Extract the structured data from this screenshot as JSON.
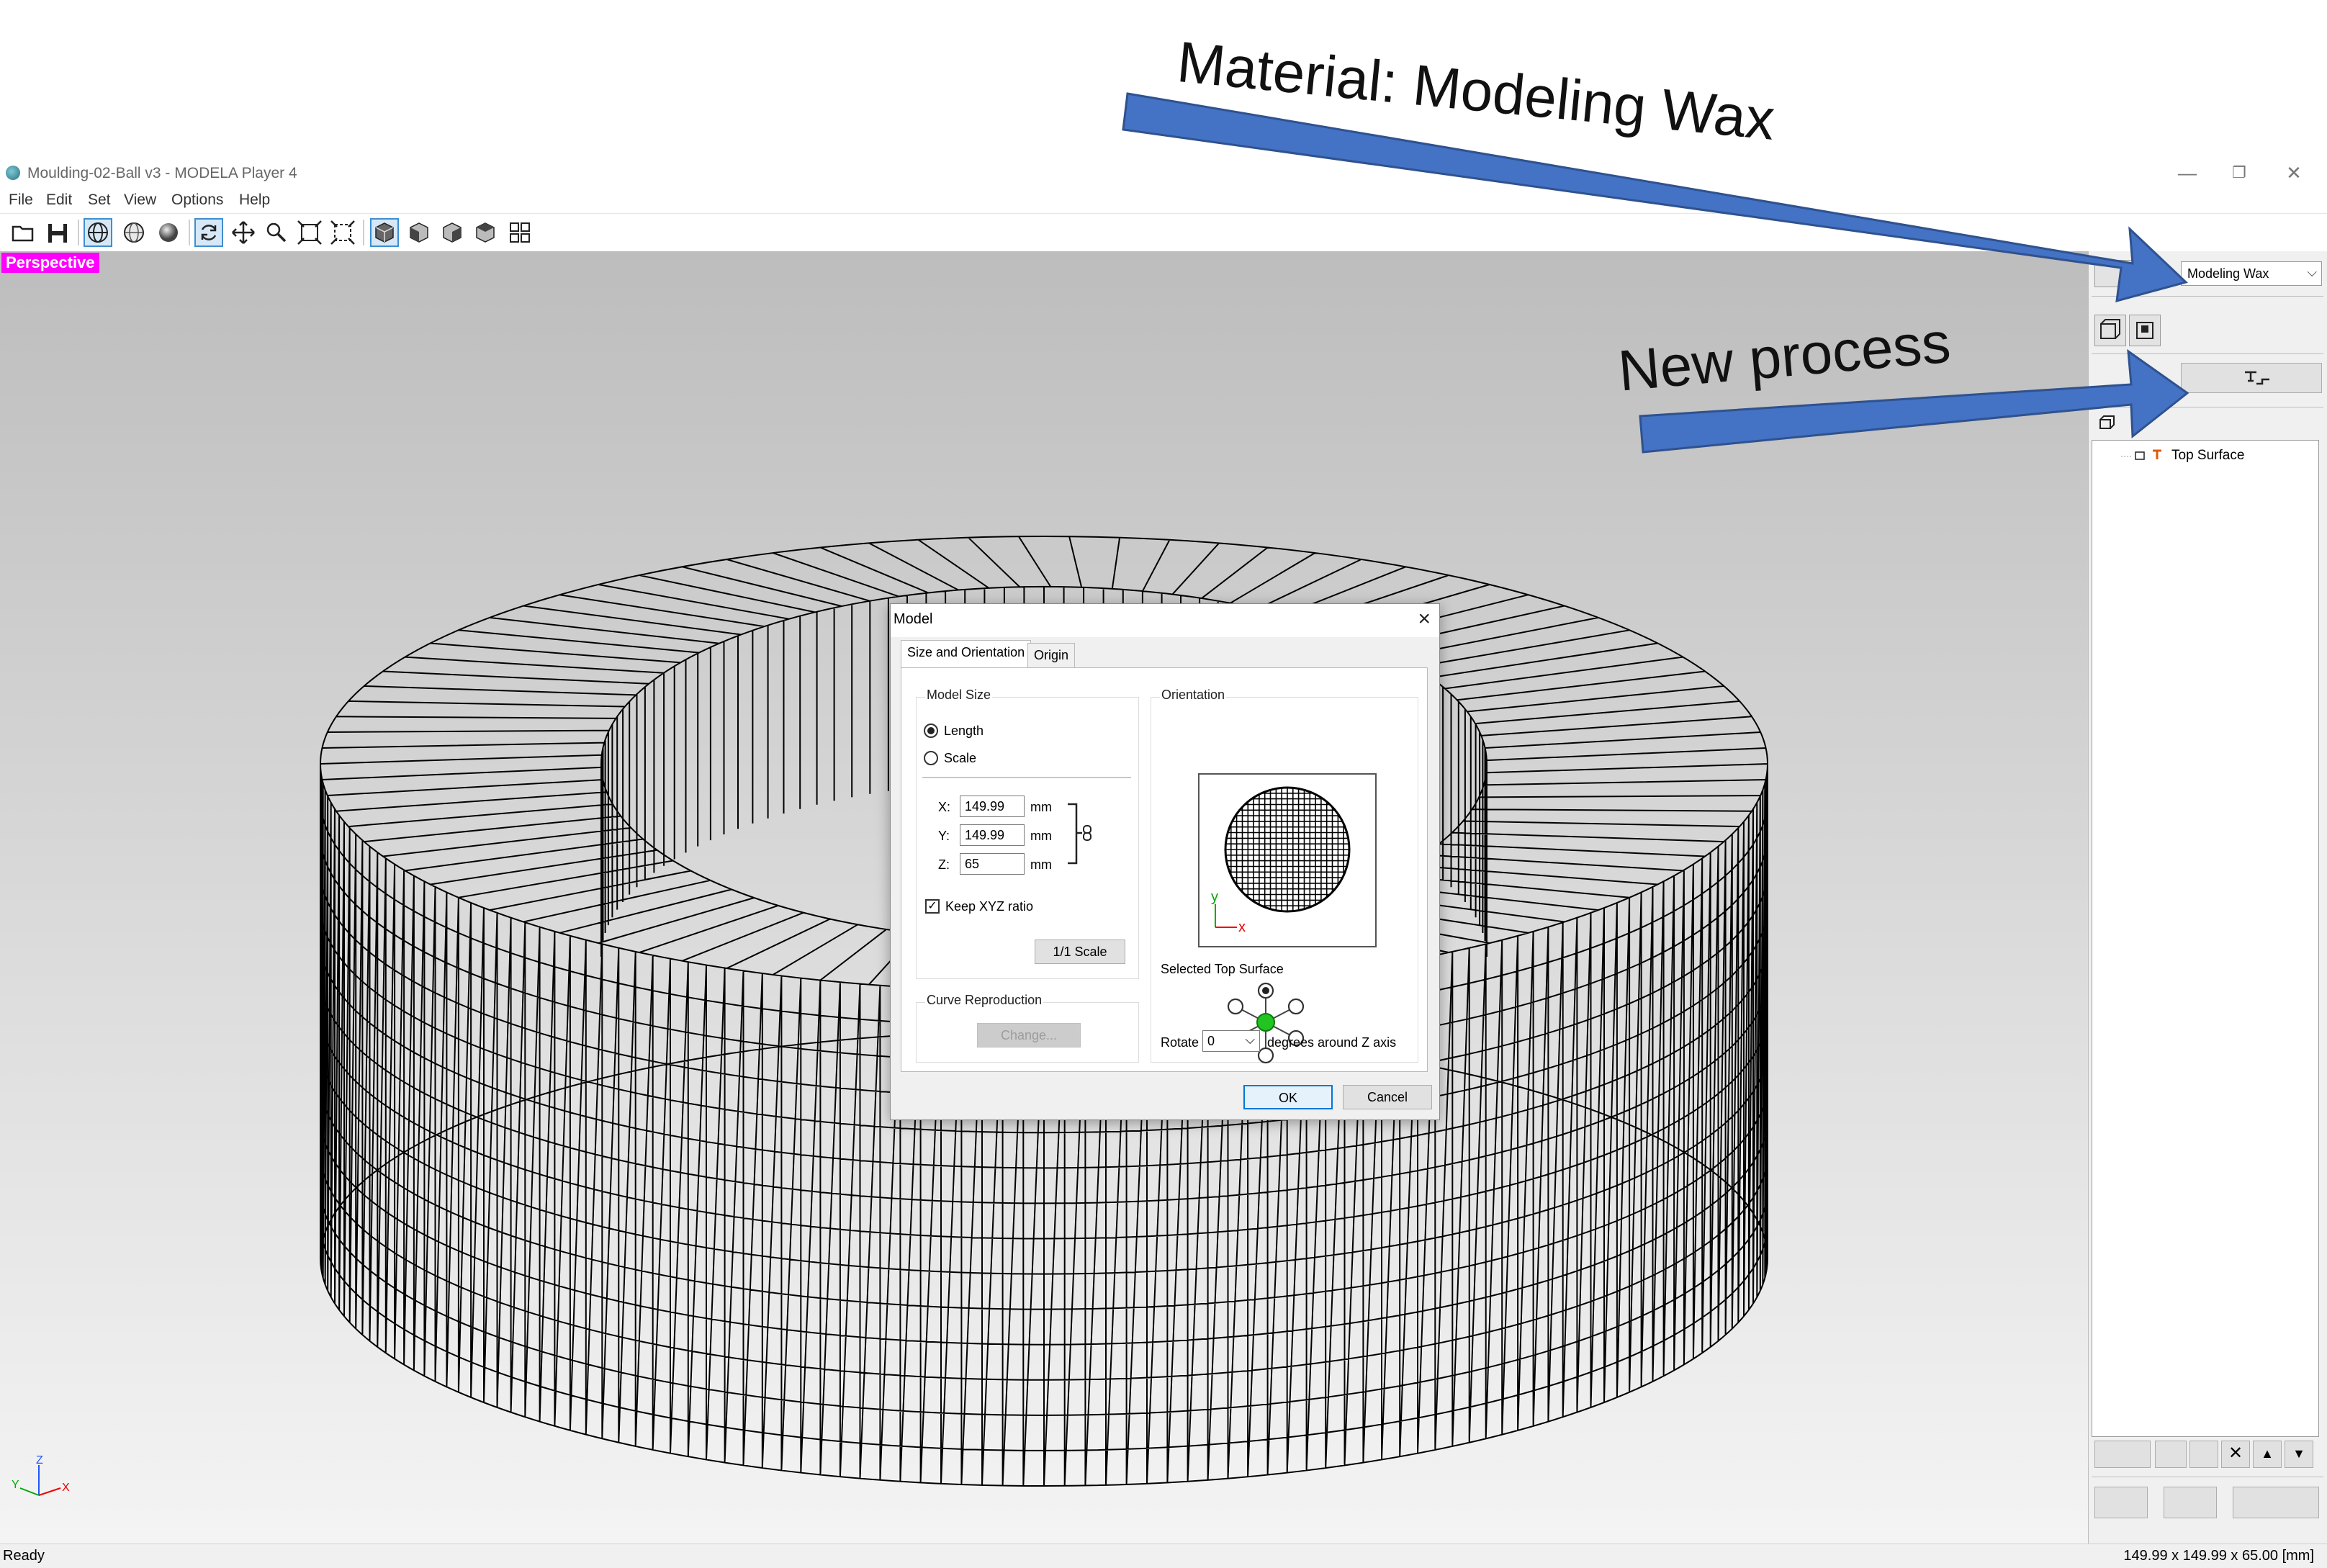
{
  "annotations": {
    "material_callout": "Material: Modeling Wax",
    "process_callout": "New process"
  },
  "window": {
    "title": "Moulding-02-Ball v3 - MODELA Player 4",
    "minimize": "—",
    "restore": "❐",
    "close": "✕"
  },
  "menu": {
    "items": [
      "File",
      "Edit",
      "Set",
      "View",
      "Options",
      "Help"
    ]
  },
  "toolbar": {
    "icons": [
      "open-icon",
      "save-icon",
      "wireframe-icon",
      "surface-icon",
      "render-icon",
      "rotate-icon",
      "pan-icon",
      "zoom-icon",
      "fit-icon",
      "select-fit-icon",
      "view-iso-icon",
      "view-front-icon",
      "view-right-icon",
      "view-left-icon",
      "view-quad-icon"
    ]
  },
  "viewport": {
    "label": "Perspective",
    "axis_x": "X",
    "axis_y": "Y",
    "axis_z": "Z"
  },
  "right_panel": {
    "material": "Modeling Wax",
    "tree_item": "Top Surface"
  },
  "status": {
    "left": "Ready",
    "right": "149.99 x 149.99 x 65.00 [mm]"
  },
  "dialog": {
    "title": "Model",
    "tabs": [
      "Size and Orientation",
      "Origin"
    ],
    "model_size": {
      "group_title": "Model Size",
      "length_label": "Length",
      "scale_label": "Scale",
      "selected": "Length",
      "x_label": "X:",
      "y_label": "Y:",
      "z_label": "Z:",
      "x_value": "149.99",
      "y_value": "149.99",
      "z_value": "65",
      "unit": "mm",
      "keep_ratio_label": "Keep XYZ ratio",
      "keep_ratio_checked": "✓",
      "one_scale_button": "1/1 Scale"
    },
    "curve": {
      "group_title": "Curve Reproduction",
      "change_button": "Change..."
    },
    "orientation": {
      "group_title": "Orientation",
      "selected_surface_label": "Selected Top Surface",
      "rotate_label": "Rotate",
      "rotate_value": "0",
      "rotate_suffix": "degrees around Z axis",
      "preview_x": "x",
      "preview_y": "y"
    },
    "ok_button": "OK",
    "cancel_button": "Cancel"
  },
  "colors": {
    "annotation_arrow": "#4472c4",
    "perspective_badge": "#ff00ff",
    "selection": "#0078d7"
  }
}
